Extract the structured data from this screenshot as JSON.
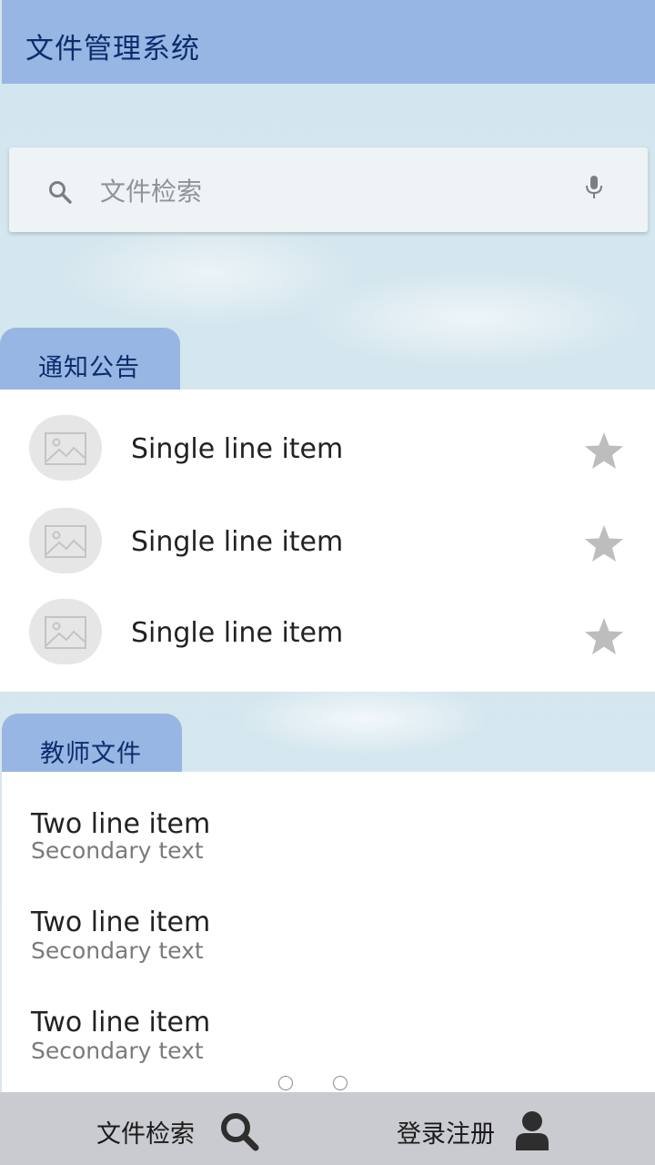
{
  "appbar": {
    "title": "文件管理系统"
  },
  "search": {
    "placeholder": "文件检索"
  },
  "notices": {
    "tab_label": "通知公告",
    "items": [
      {
        "label": "Single line item"
      },
      {
        "label": "Single line item"
      },
      {
        "label": "Single line item"
      }
    ]
  },
  "teacher_files": {
    "tab_label": "教师文件",
    "items": [
      {
        "primary": "Two line item",
        "secondary": "Secondary text"
      },
      {
        "primary": "Two line item",
        "secondary": "Secondary text"
      },
      {
        "primary": "Two line item",
        "secondary": "Secondary text"
      }
    ]
  },
  "pager": {
    "count": 2
  },
  "bottom_nav": [
    {
      "label": "文件检索",
      "icon": "search-icon"
    },
    {
      "label": "登录注册",
      "icon": "user-icon"
    }
  ],
  "colors": {
    "appbar": "#97b6e3",
    "appbar_text": "#0d2c6c",
    "bottom_nav": "#cacbd0",
    "star": "#bdbdbd"
  }
}
